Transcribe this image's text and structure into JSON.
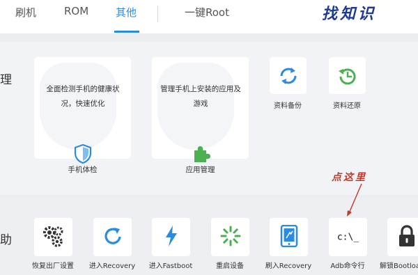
{
  "tabs": [
    {
      "label": "刷机"
    },
    {
      "label": "ROM"
    },
    {
      "label": "其他"
    },
    {
      "label": "一键Root"
    }
  ],
  "active_tab": "其他",
  "watermark": "找知识",
  "manage": {
    "title": "理",
    "health_check": {
      "description": "全面检测手机的健康状况，快速优化",
      "label": "手机体检",
      "icon": "shield-icon"
    },
    "app_manage": {
      "description": "管理手机上安装的应用及游戏",
      "label": "应用管理",
      "icon": "puzzle-icon"
    },
    "backup": {
      "label": "资料备份",
      "icon": "sync-icon"
    },
    "restore": {
      "label": "资料还原",
      "icon": "history-icon"
    }
  },
  "help": {
    "title": "助",
    "tools": [
      {
        "label": "恢复出厂设置",
        "icon": "gears-icon"
      },
      {
        "label": "进入Recovery",
        "icon": "refresh-icon"
      },
      {
        "label": "进入Fastboot",
        "icon": "lightning-icon"
      },
      {
        "label": "重启设备",
        "icon": "spinner-icon"
      },
      {
        "label": "刷入Recovery",
        "icon": "tablet-icon"
      },
      {
        "label": "Adb命令行",
        "icon": "terminal-icon",
        "icon_text": "c:\\_"
      },
      {
        "label": "解锁Bootloa",
        "icon": "lock-icon"
      }
    ]
  },
  "annotation": "点这里",
  "colors": {
    "accent": "#2b8be0",
    "green": "#4caf50",
    "annotation_red": "#c0392b",
    "watermark_blue": "#1f3b8f"
  }
}
